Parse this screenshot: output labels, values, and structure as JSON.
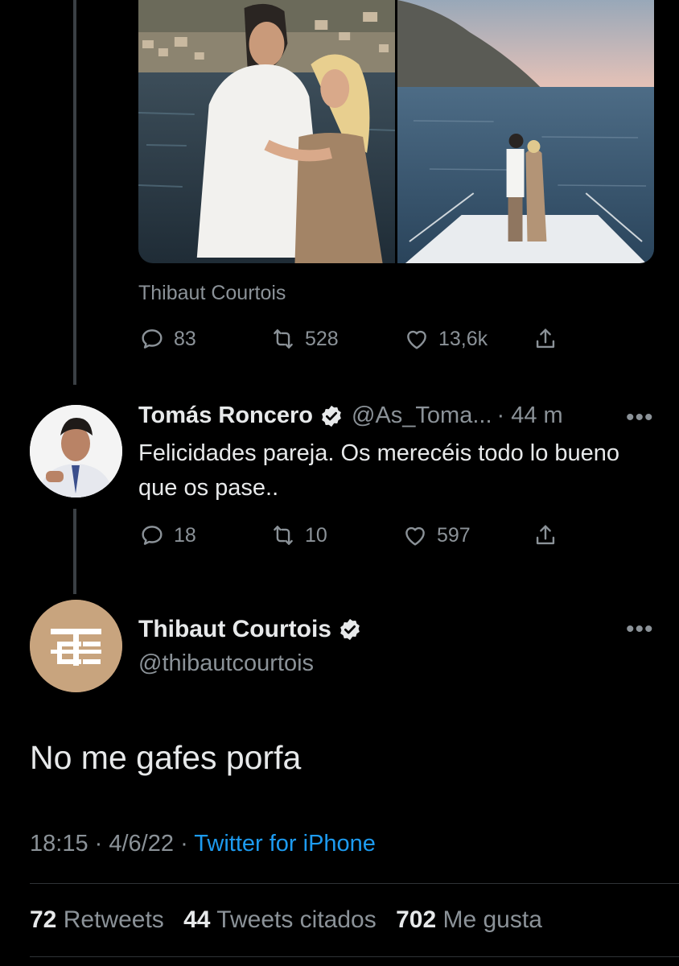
{
  "previous_tweet": {
    "media_caption": "Thibaut Courtois",
    "actions": {
      "replies": "83",
      "retweets": "528",
      "likes": "13,6k"
    }
  },
  "reply_tweet": {
    "name": "Tomás Roncero",
    "handle": "@As_Toma...",
    "time": "· 44 m",
    "text": "Felicidades pareja. Os merecéis todo lo bueno que os pase..",
    "actions": {
      "replies": "18",
      "retweets": "10",
      "likes": "597"
    }
  },
  "main_tweet": {
    "name": "Thibaut Courtois",
    "handle": "@thibautcourtois",
    "avatar_monogram": "TC",
    "text": "No me gafes porfa",
    "time": "18:15",
    "date": "4/6/22",
    "source": "Twitter for iPhone",
    "stats": {
      "retweets_count": "72",
      "retweets_label": "Retweets",
      "quotes_count": "44",
      "quotes_label": "Tweets citados",
      "likes_count": "702",
      "likes_label": "Me gusta"
    }
  },
  "more_label": "•••",
  "colors": {
    "background": "#000000",
    "text": "#e7e9ea",
    "secondary": "#8b9298",
    "accent": "#1d9bf0",
    "avatar_gold": "#c8a47e"
  }
}
